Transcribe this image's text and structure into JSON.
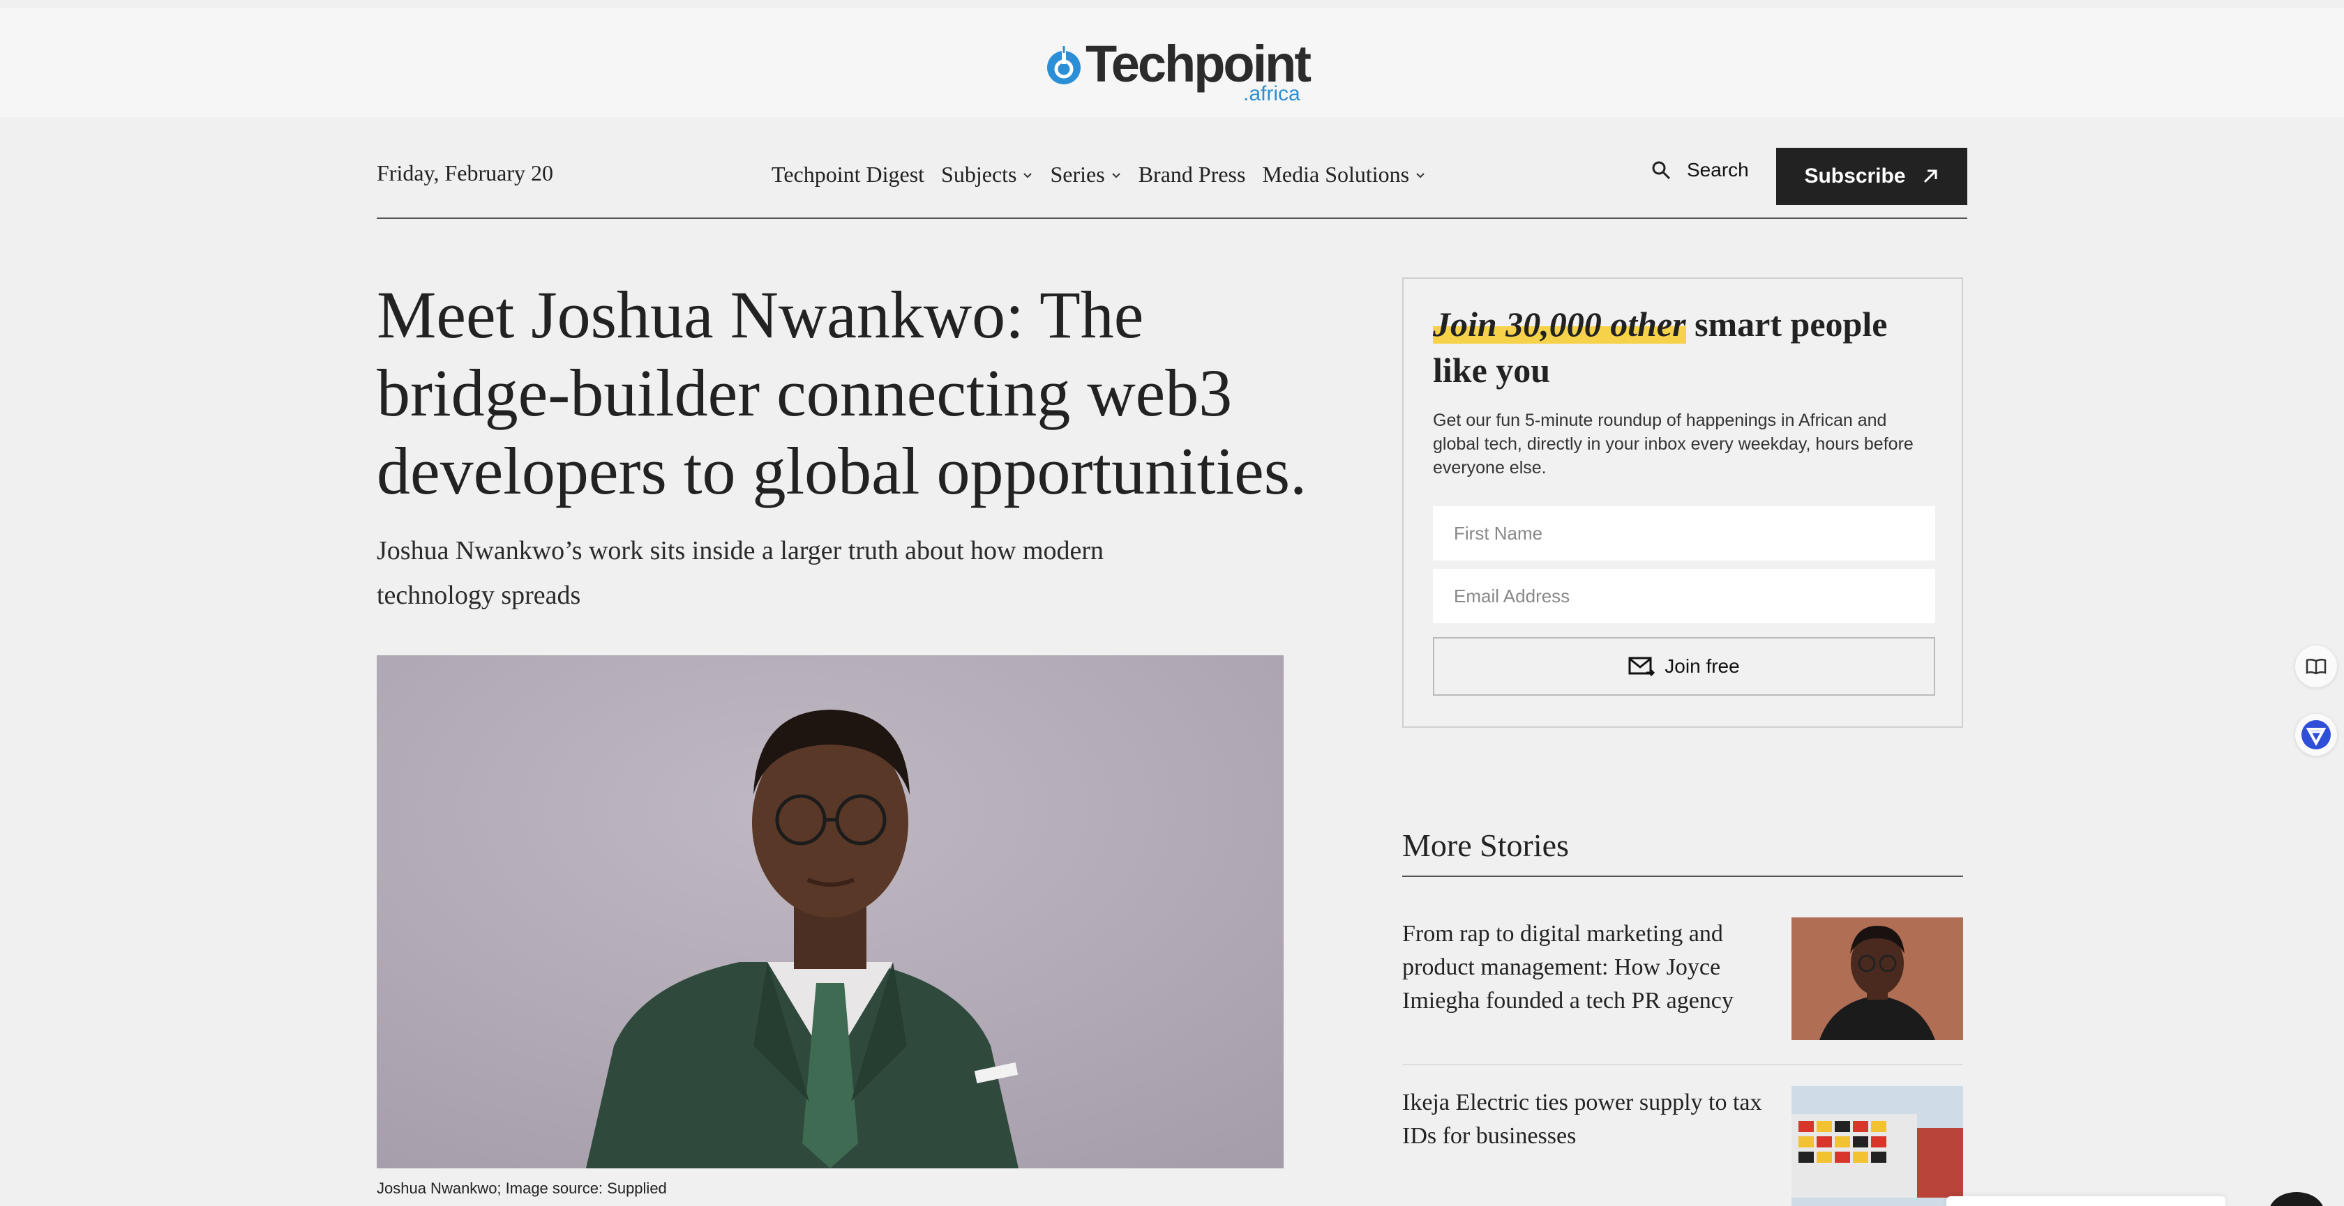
{
  "site": {
    "logo_text": "Techpoint",
    "logo_sub": ".africa",
    "logo_icon": "power-icon",
    "brand_color": "#2a8fd6"
  },
  "nav": {
    "date": "Friday, February 20",
    "links": [
      {
        "label": "Techpoint Digest",
        "dropdown": false
      },
      {
        "label": "Subjects",
        "dropdown": true
      },
      {
        "label": "Series",
        "dropdown": true
      },
      {
        "label": "Brand Press",
        "dropdown": false
      },
      {
        "label": "Media Solutions",
        "dropdown": true
      }
    ],
    "search_label": "Search",
    "subscribe_label": "Subscribe"
  },
  "article": {
    "headline": "Meet Joshua Nwankwo: The bridge-builder connecting web3 developers to global opportunities.",
    "dek": "Joshua Nwankwo’s work sits inside a larger truth about how modern technology spreads",
    "image_caption": "Joshua Nwankwo; Image source: Supplied"
  },
  "newsletter": {
    "title_highlight": "Join 30,000 other",
    "title_rest": " smart people like you",
    "description": "Get our fun 5-minute roundup of happenings in African and global tech, directly in your inbox every weekday, hours before everyone else.",
    "first_name_placeholder": "First Name",
    "email_placeholder": "Email Address",
    "button_label": "Join free",
    "highlight_color": "#f5d24a"
  },
  "more_stories": {
    "title": "More Stories",
    "items": [
      {
        "title": "From rap to digital marketing and product management: How Joyce Imiegha founded a tech PR agency"
      },
      {
        "title": "Ikeja Electric ties power supply to tax IDs for businesses"
      }
    ]
  }
}
